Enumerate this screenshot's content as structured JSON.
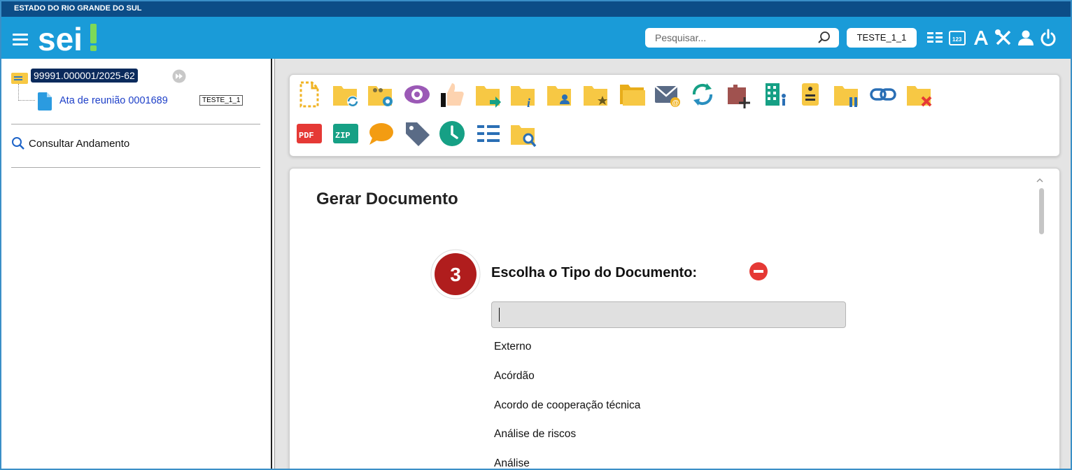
{
  "header": {
    "state_name": "ESTADO DO RIO GRANDE DO SUL",
    "logo_text": "sei!",
    "search": {
      "placeholder": "Pesquisar...",
      "value": ""
    },
    "unit_badge": "TESTE_1_1",
    "icons": [
      "menu-icon",
      "search-icon",
      "list-icon",
      "calendar-icon",
      "font-size-icon",
      "tools-icon",
      "user-icon",
      "power-icon"
    ]
  },
  "tree": {
    "process_number": "99991.000001/2025-62",
    "document": {
      "label": "Ata de reunião 0001689",
      "unit": "TESTE_1_1"
    },
    "consult_label": "Consultar Andamento"
  },
  "toolbar": {
    "icons": [
      "new-document-icon",
      "reopen-process-icon",
      "assign-process-icon",
      "view-access-icon",
      "sign-icon",
      "send-process-icon",
      "process-info-icon",
      "process-assign-user-icon",
      "follow-process-icon",
      "open-folder-icon",
      "send-email-icon",
      "sync-icon",
      "add-block-icon",
      "organization-icon",
      "document-note-icon",
      "suspend-process-icon",
      "link-process-icon",
      "close-process-icon",
      "pdf-icon",
      "zip-icon",
      "comment-icon",
      "tag-icon",
      "clock-icon",
      "list-view-icon",
      "search-folder-icon"
    ],
    "colors": {
      "folder": "#f7c844",
      "folder_dark": "#e8ad1a",
      "blue": "#2a8fbf",
      "green": "#16a085",
      "purple": "#8e5fb3"
    }
  },
  "content": {
    "title": "Gerar Documento",
    "step_number": "3",
    "choose_label": "Escolha o Tipo do Documento:",
    "filter_value": "",
    "document_types": [
      "Externo",
      "Acórdão",
      "Acordo de cooperação técnica",
      "Análise de riscos",
      "Análise"
    ]
  },
  "colors": {
    "state_bar": "#0c4d87",
    "header": "#1a9bd8",
    "process_highlight": "#0a2a5c",
    "doc_link": "#1d3fc8",
    "step_badge": "#b01d1d",
    "collapse_icon": "#e53935"
  }
}
